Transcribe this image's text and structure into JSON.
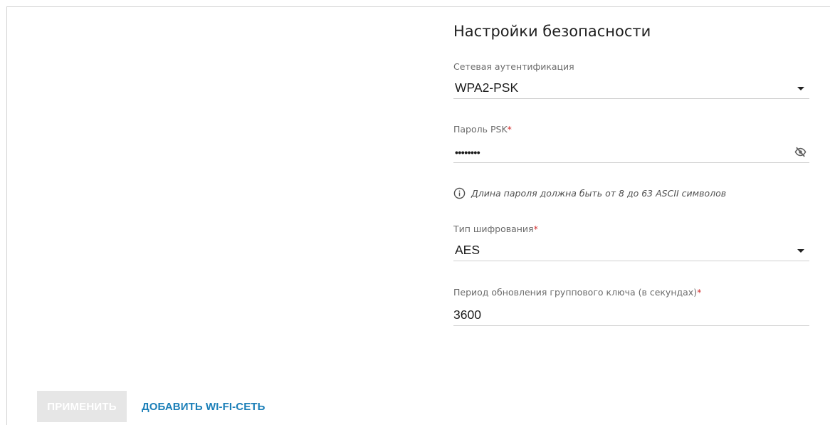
{
  "security": {
    "title": "Настройки безопасности",
    "auth": {
      "label": "Сетевая аутентификация",
      "value": "WPA2-PSK"
    },
    "password": {
      "label": "Пароль PSK",
      "required_mark": "*",
      "value": "••••••••",
      "icon": "eye-off-icon"
    },
    "hint": {
      "icon": "info-icon",
      "text": "Длина пароля должна быть от 8 до 63 ASCII символов"
    },
    "encryption": {
      "label": "Тип шифрования",
      "required_mark": "*",
      "value": "AES"
    },
    "rekey": {
      "label": "Период обновления группового ключа (в секундах)",
      "required_mark": "*",
      "value": "3600"
    }
  },
  "actions": {
    "apply_label": "ПРИМЕНИТЬ",
    "add_wifi_label": "ДОБАВИТЬ WI-FI-СЕТЬ"
  },
  "colors": {
    "accent": "#1b7fb8",
    "required": "#d32f2f",
    "disabled_button_bg": "#e6e6e6"
  }
}
